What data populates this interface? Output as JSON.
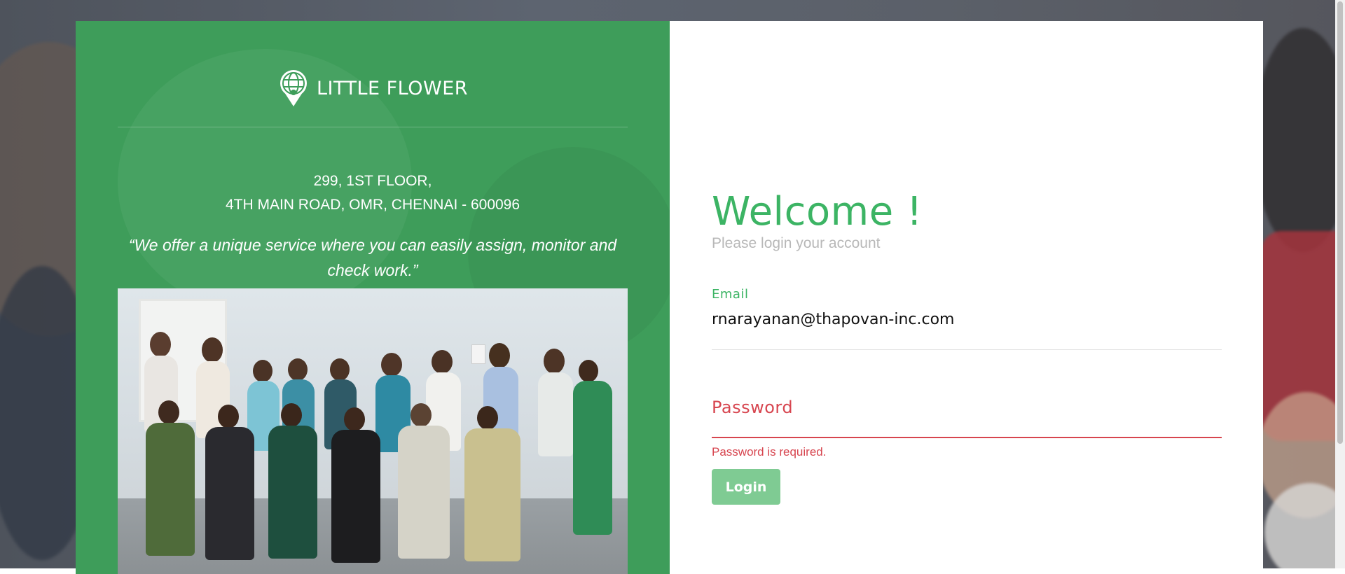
{
  "brand": {
    "name": "LITTLE FLOWER",
    "logo_icon": "globe-pin-icon"
  },
  "address": {
    "line1": "299, 1ST FLOOR,",
    "line2": "4TH MAIN ROAD, OMR, CHENNAI - 600096"
  },
  "quote": "“We offer a unique service where you can easily assign, monitor and check work.”",
  "photo": {
    "description_icon": "group-photo-image"
  },
  "login": {
    "title": "Welcome !",
    "subtitle": "Please login your account",
    "email_label": "Email",
    "email_value": "rnarayanan@thapovan-inc.com",
    "password_label": "Password",
    "password_error": "Password is required.",
    "button_label": "Login"
  },
  "colors": {
    "brand_green": "#3e9d5a",
    "accent_green": "#3cb464",
    "error_red": "#d7454f",
    "button_green": "#7fcb93"
  }
}
